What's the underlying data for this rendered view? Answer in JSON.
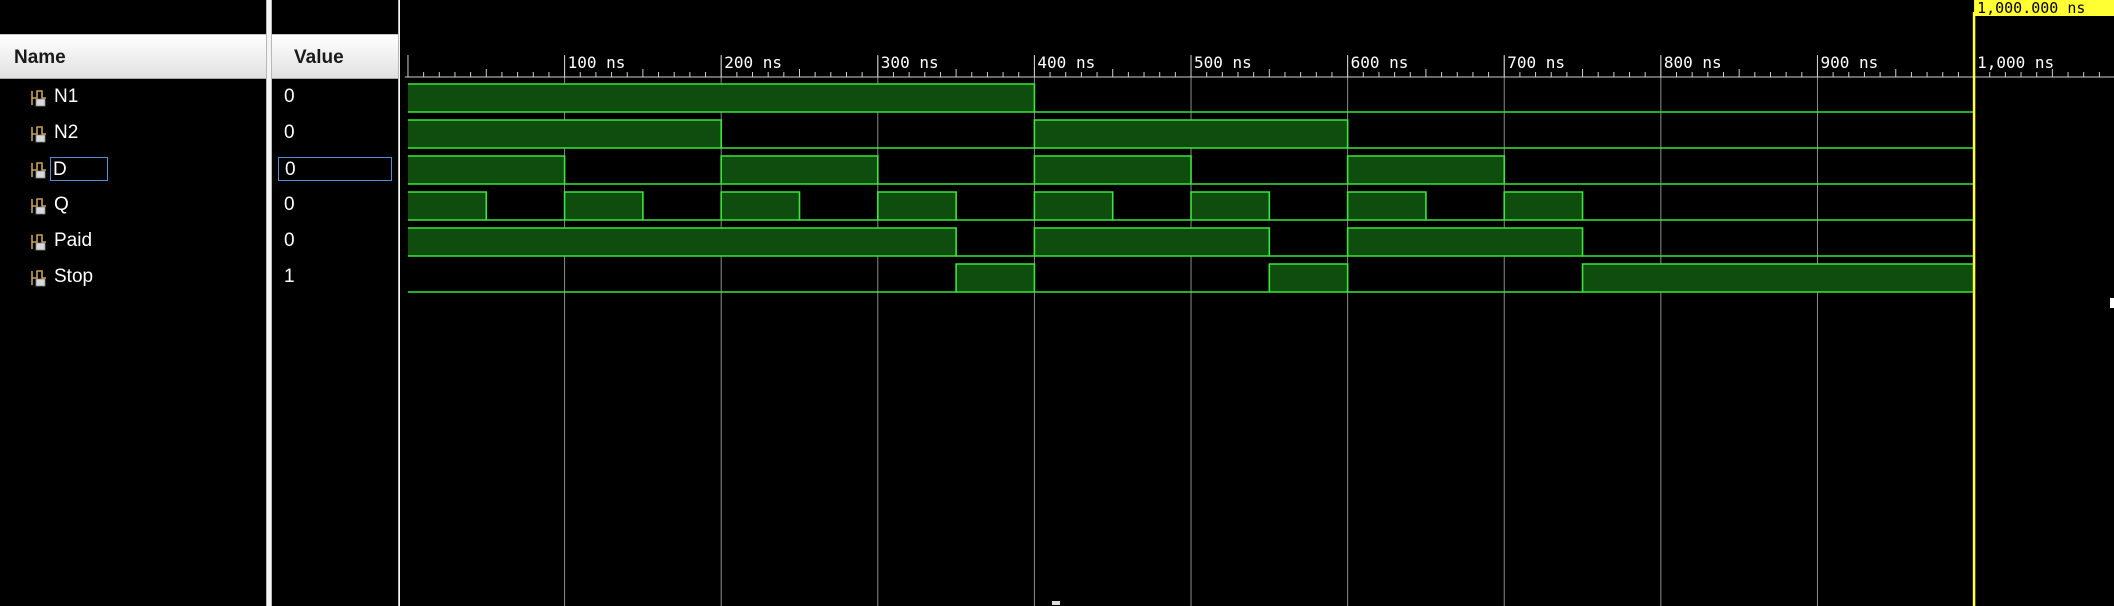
{
  "headers": {
    "name": "Name",
    "value": "Value"
  },
  "signals": [
    {
      "name": "N1",
      "value": "0",
      "icon": "signal-scalar-icon",
      "waveform": [
        [
          0,
          1
        ],
        [
          400,
          0
        ],
        [
          1000,
          0
        ]
      ]
    },
    {
      "name": "N2",
      "value": "0",
      "icon": "signal-scalar-icon",
      "waveform": [
        [
          0,
          1
        ],
        [
          200,
          0
        ],
        [
          400,
          1
        ],
        [
          600,
          0
        ],
        [
          1000,
          0
        ]
      ]
    },
    {
      "name": "D",
      "value": "0",
      "icon": "signal-scalar-icon",
      "selected": true,
      "waveform": [
        [
          0,
          1
        ],
        [
          100,
          0
        ],
        [
          200,
          1
        ],
        [
          300,
          0
        ],
        [
          400,
          1
        ],
        [
          500,
          0
        ],
        [
          600,
          1
        ],
        [
          700,
          0
        ],
        [
          1000,
          0
        ]
      ]
    },
    {
      "name": "Q",
      "value": "0",
      "icon": "signal-scalar-icon",
      "waveform": [
        [
          0,
          1
        ],
        [
          50,
          0
        ],
        [
          100,
          1
        ],
        [
          150,
          0
        ],
        [
          200,
          1
        ],
        [
          250,
          0
        ],
        [
          300,
          1
        ],
        [
          350,
          0
        ],
        [
          400,
          1
        ],
        [
          450,
          0
        ],
        [
          500,
          1
        ],
        [
          550,
          0
        ],
        [
          600,
          1
        ],
        [
          650,
          0
        ],
        [
          700,
          1
        ],
        [
          750,
          0
        ],
        [
          1000,
          0
        ]
      ]
    },
    {
      "name": "Paid",
      "value": "0",
      "icon": "signal-scalar-icon",
      "waveform": [
        [
          0,
          1
        ],
        [
          350,
          0
        ],
        [
          400,
          1
        ],
        [
          550,
          0
        ],
        [
          600,
          1
        ],
        [
          750,
          0
        ],
        [
          1000,
          0
        ]
      ]
    },
    {
      "name": "Stop",
      "value": "1",
      "icon": "signal-scalar-icon",
      "waveform": [
        [
          0,
          0
        ],
        [
          350,
          1
        ],
        [
          400,
          0
        ],
        [
          550,
          1
        ],
        [
          600,
          0
        ],
        [
          750,
          1
        ],
        [
          1000,
          1
        ]
      ]
    }
  ],
  "timeline": {
    "unit": "ns",
    "range": [
      -2,
      1090
    ],
    "major_ticks": [
      {
        "t": 100,
        "label": "100 ns"
      },
      {
        "t": 200,
        "label": "200 ns"
      },
      {
        "t": 300,
        "label": "300 ns"
      },
      {
        "t": 400,
        "label": "400 ns"
      },
      {
        "t": 500,
        "label": "500 ns"
      },
      {
        "t": 600,
        "label": "600 ns"
      },
      {
        "t": 700,
        "label": "700 ns"
      },
      {
        "t": 800,
        "label": "800 ns"
      },
      {
        "t": 900,
        "label": "900 ns"
      },
      {
        "t": 1000,
        "label": "1,000 ns"
      }
    ],
    "minor_tick_step": 10,
    "cursor": {
      "t": 1000,
      "label": "1,000.000 ns"
    },
    "sim_end": 1000
  },
  "colors": {
    "background": "#000000",
    "wave_line": "#39e639",
    "wave_fill": "#0e4d0e",
    "grid": "#8c8c8c",
    "cursor": "#ffff33",
    "cursor_label_bg": "#ffff33",
    "ruler_text": "#ffffff"
  }
}
